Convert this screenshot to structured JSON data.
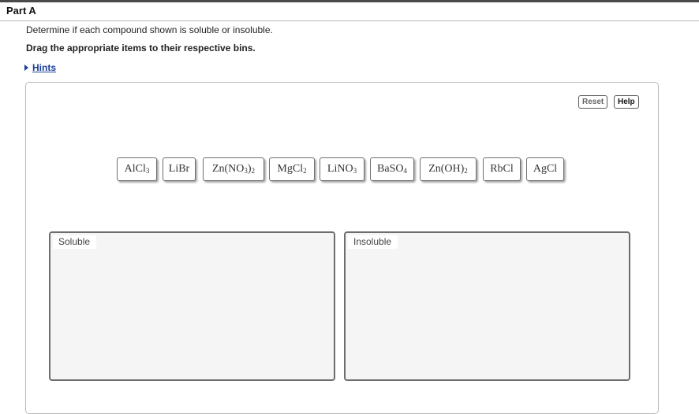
{
  "header": {
    "part_title": "Part A"
  },
  "instructions": {
    "line1": "Determine if each compound shown is soluble or insoluble.",
    "line2": "Drag the appropriate items to their respective bins."
  },
  "hints": {
    "label": "Hints"
  },
  "toolbar": {
    "reset_label": "Reset",
    "help_label": "Help"
  },
  "compounds": [
    {
      "name": "AlCl3",
      "parts": [
        "AlCl",
        "3",
        "",
        ""
      ]
    },
    {
      "name": "LiBr",
      "parts": [
        "LiBr",
        "",
        "",
        ""
      ]
    },
    {
      "name": "Zn(NO3)2",
      "parts": [
        "Zn(NO",
        "3",
        ")",
        "2"
      ]
    },
    {
      "name": "MgCl2",
      "parts": [
        "MgCl",
        "2",
        "",
        ""
      ]
    },
    {
      "name": "LiNO3",
      "parts": [
        "LiNO",
        "3",
        "",
        ""
      ]
    },
    {
      "name": "BaSO4",
      "parts": [
        "BaSO",
        "4",
        "",
        ""
      ]
    },
    {
      "name": "Zn(OH)2",
      "parts": [
        "Zn(OH)",
        "2",
        "",
        ""
      ]
    },
    {
      "name": "RbCl",
      "parts": [
        "RbCl",
        "",
        "",
        ""
      ]
    },
    {
      "name": "AgCl",
      "parts": [
        "AgCl",
        "",
        "",
        ""
      ]
    }
  ],
  "bins": {
    "soluble": {
      "label": "Soluble"
    },
    "insoluble": {
      "label": "Insoluble"
    }
  },
  "colors": {
    "link": "#1a3f9a",
    "bin_background": "#f5f5f5",
    "top_bar": "#4a4a4a"
  }
}
